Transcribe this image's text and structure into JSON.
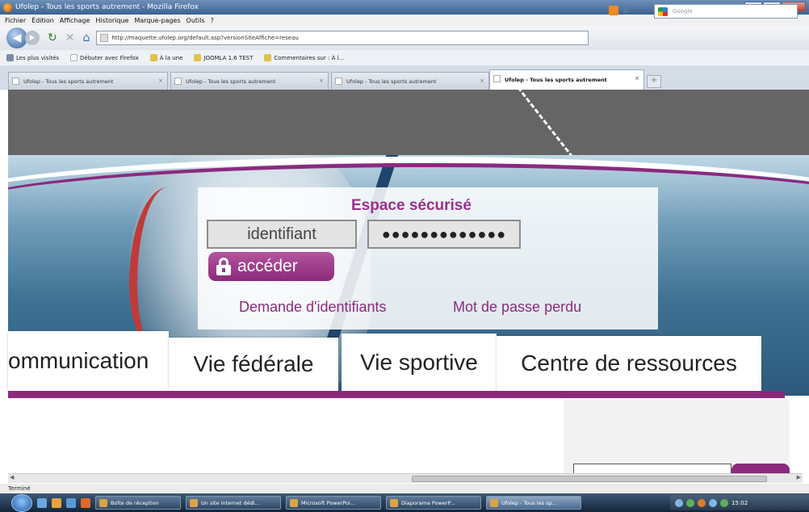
{
  "browser": {
    "window_title": "Ufolep - Tous les sports autrement - Mozilla Firefox",
    "menu": [
      "Fichier",
      "Édition",
      "Affichage",
      "Historique",
      "Marque-pages",
      "Outils",
      "?"
    ],
    "url": "http://maquette.ufolep.org/default.asp?versionSiteAffiche=reseau",
    "search_placeholder": "Google",
    "bookmarks": [
      "Les plus visités",
      "Débuter avec Firefox",
      "À la une",
      "JOOMLA 1.6 TEST",
      "Commentaires sur : À l..."
    ],
    "tabs": [
      "Ufolep - Tous les sports autrement",
      "Ufolep - Tous les sports autrement",
      "Ufolep - Tous les sports autrement",
      "Ufolep - Tous les sports autrement"
    ],
    "status": "Terminé"
  },
  "login": {
    "title": "Espace sécurisé",
    "id_value": "identifiant",
    "password_mask": "●●●●●●●●●●●●●",
    "submit_label": "accéder",
    "link_request": "Demande d'identifiants",
    "link_lost": "Mot de passe perdu"
  },
  "nav": [
    "ommunication",
    "Vie fédérale",
    "Vie sportive",
    "Centre de ressources"
  ],
  "taskbar": {
    "tasks": [
      "Boîte de réception",
      "Un site internet dédi...",
      "Microsoft PowerPoi...",
      "Diaporama PowerP...",
      "Ufolep - Tous les sp..."
    ],
    "clock": "15:02"
  },
  "colors": {
    "brand_purple": "#8b2a7a",
    "gray_band": "#656565"
  }
}
